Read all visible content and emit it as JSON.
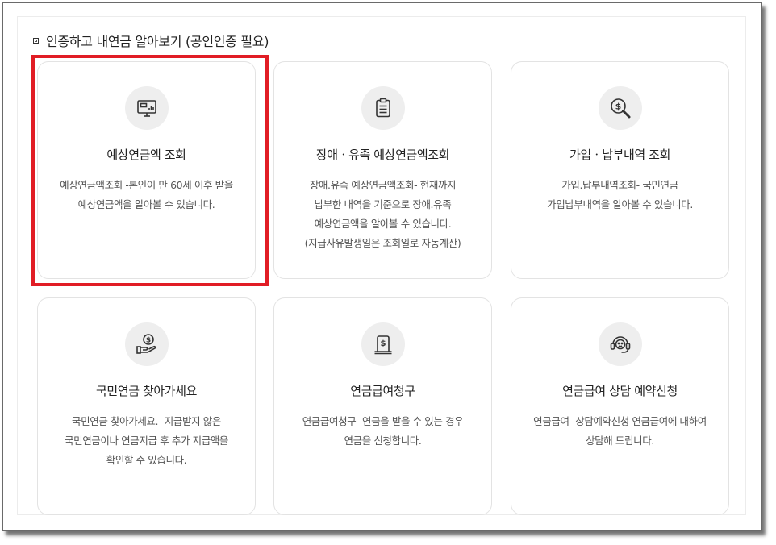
{
  "section": {
    "heading": "인증하고 내연금 알아보기 (공인인증 필요)"
  },
  "cards": [
    {
      "icon": "monitor-chart-icon",
      "title": "예상연금액 조회",
      "lines": [
        "예상연금액조회 -본인이 만 60세 이후 받을",
        "예상연금액을 알아볼 수 있습니다."
      ]
    },
    {
      "icon": "clipboard-icon",
      "title": "장애ㆍ유족 예상연금액조회",
      "lines": [
        "장애.유족 예상연금액조회- 현재까지",
        "납부한 내역을 기준으로 장애.유족",
        "예상연금액을 알아볼 수 있습니다.",
        "(지급사유발생일은 조회일로 자동계산)"
      ]
    },
    {
      "icon": "search-dollar-icon",
      "title": "가입ㆍ납부내역 조회",
      "lines": [
        "가입.납부내역조회- 국민연금",
        "가입납부내역을 알아볼 수 있습니다."
      ]
    },
    {
      "icon": "hand-coin-icon",
      "title": "국민연금 찾아가세요",
      "lines": [
        "국민연금 찾아가세요.- 지급받지 않은",
        "국민연금이나 연금지급 후 추가 지급액을",
        "확인할 수 있습니다."
      ]
    },
    {
      "icon": "document-dollar-icon",
      "title": "연금급여청구",
      "lines": [
        "연금급여청구- 연금을 받을 수 있는 경우",
        "연금을 신청합니다."
      ]
    },
    {
      "icon": "headset-icon",
      "title": "연금급여 상담 예약신청",
      "lines": [
        "연금급여 -상담예약신청 연금급여에 대하여",
        "상담해 드립니다."
      ]
    }
  ],
  "colors": {
    "highlight": "#e11d25",
    "icon_bg": "#eeeeee",
    "icon_stroke": "#333333"
  }
}
